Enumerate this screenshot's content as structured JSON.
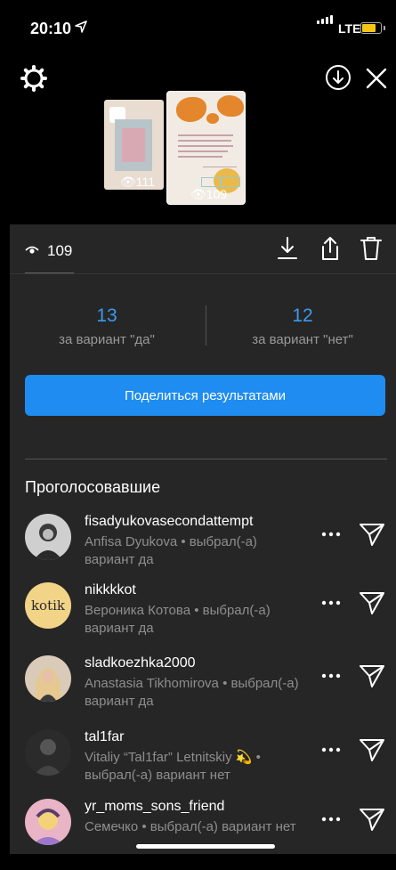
{
  "status_bar": {
    "time": "20:10",
    "network": "LTE"
  },
  "story": {
    "thumb1_views": "111",
    "thumb2_views": "109"
  },
  "viewers": {
    "count": "109"
  },
  "poll": {
    "option_yes": {
      "count": "13",
      "label": "за вариант \"да\""
    },
    "option_no": {
      "count": "12",
      "label": "за вариант \"нет\""
    }
  },
  "share_button_label": "Поделиться результатами",
  "voters_title": "Проголосовавшие",
  "voters": [
    {
      "username": "fisadyukovasecondattempt",
      "detail": "Anfisa Dyukova • выбрал(-а) вариант да"
    },
    {
      "username": "nikkkkot",
      "detail": "Вероника Котова • выбрал(-а) вариант да",
      "avatar_text": "kotik"
    },
    {
      "username": "sladkoezhka2000",
      "detail": "Anastasia Tikhomirova • выбрал(-а) вариант да"
    },
    {
      "username": "tal1far",
      "detail": "Vitaliy “Tal1far” Letnitskiy 💫 • выбрал(-а) вариант нет"
    },
    {
      "username": "yr_moms_sons_friend",
      "detail": "Семечко • выбрал(-а) вариант нет"
    }
  ],
  "colors": {
    "accent": "#1e8cf0",
    "stat_number": "#3b9aef",
    "panel": "#262626"
  },
  "icons": [
    "location-arrow-icon",
    "signal-icon",
    "battery-icon",
    "settings-icon",
    "download-circle-icon",
    "close-icon",
    "eye-icon",
    "download-icon",
    "share-icon",
    "trash-icon",
    "more-icon",
    "send-icon"
  ]
}
